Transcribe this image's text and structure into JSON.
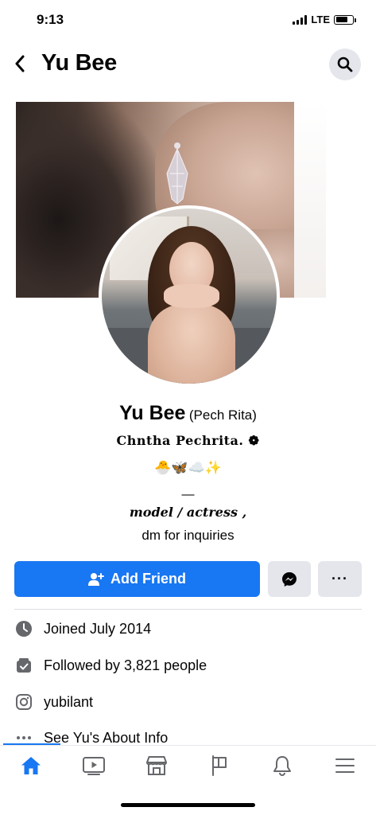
{
  "status_bar": {
    "time": "9:13",
    "network": "LTE",
    "battery_level": 0.7
  },
  "header": {
    "title": "Yu Bee",
    "back_icon": "chevron-left-icon",
    "search_icon": "search-icon"
  },
  "profile": {
    "name": "Yu Bee",
    "alternate_name": "(Pech Rita)",
    "bio_line1": "Chntha Pechrita. ❁",
    "bio_emoji": "🐣🦋☁️✨",
    "bio_dash": "—",
    "bio_role": "model / actress ,",
    "bio_contact": "dm for inquiries"
  },
  "actions": {
    "add_friend_label": "Add Friend",
    "more_label": "···"
  },
  "info": [
    {
      "icon": "clock-icon",
      "text": "Joined July 2014"
    },
    {
      "icon": "followers-icon",
      "text": "Followed by 3,821 people"
    },
    {
      "icon": "instagram-icon",
      "text": "yubilant"
    },
    {
      "icon": "more-dots-icon",
      "text": "See Yu's About Info"
    }
  ],
  "tabs": [
    {
      "name": "home",
      "icon": "home-icon",
      "active": true
    },
    {
      "name": "watch",
      "icon": "video-icon",
      "active": false
    },
    {
      "name": "marketplace",
      "icon": "marketplace-icon",
      "active": false
    },
    {
      "name": "pages",
      "icon": "flag-icon",
      "active": false
    },
    {
      "name": "notifications",
      "icon": "bell-icon",
      "active": false
    },
    {
      "name": "menu",
      "icon": "menu-icon",
      "active": false
    }
  ],
  "colors": {
    "accent": "#1877f2",
    "button_gray": "#e4e6eb",
    "text": "#050505"
  }
}
